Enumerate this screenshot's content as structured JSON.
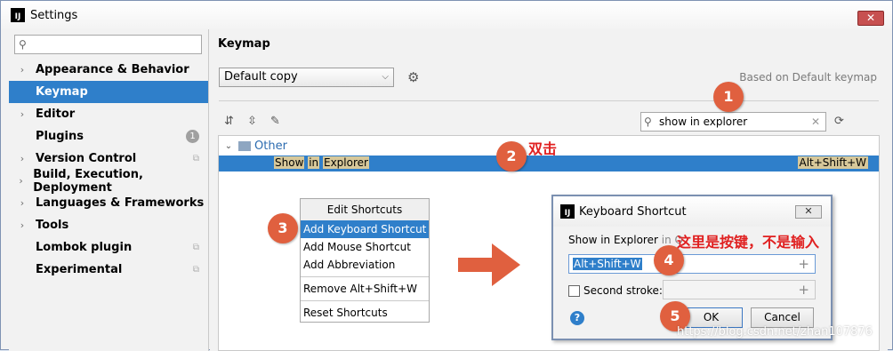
{
  "window": {
    "title": "Settings",
    "app_icon": "IJ"
  },
  "sidebar": {
    "search_placeholder": "",
    "items": [
      {
        "label": "Appearance & Behavior",
        "expandable": true,
        "selected": false,
        "extra": ""
      },
      {
        "label": "Keymap",
        "expandable": false,
        "selected": true,
        "extra": ""
      },
      {
        "label": "Editor",
        "expandable": true,
        "selected": false,
        "extra": ""
      },
      {
        "label": "Plugins",
        "expandable": false,
        "selected": false,
        "extra": "1"
      },
      {
        "label": "Version Control",
        "expandable": true,
        "selected": false,
        "extra": "copy-icon"
      },
      {
        "label": "Build, Execution, Deployment",
        "expandable": true,
        "selected": false,
        "extra": ""
      },
      {
        "label": "Languages & Frameworks",
        "expandable": true,
        "selected": false,
        "extra": ""
      },
      {
        "label": "Tools",
        "expandable": true,
        "selected": false,
        "extra": ""
      },
      {
        "label": "Lombok plugin",
        "expandable": false,
        "selected": false,
        "extra": "copy-icon"
      },
      {
        "label": "Experimental",
        "expandable": false,
        "selected": false,
        "extra": "copy-icon"
      }
    ]
  },
  "main": {
    "title": "Keymap",
    "keymap_value": "Default copy",
    "based_on": "Based on Default keymap",
    "search_value": "show in explorer",
    "tree": {
      "group": "Other",
      "action_parts": [
        "Show",
        "in",
        "Explorer"
      ],
      "shortcut": "Alt+Shift+W"
    }
  },
  "context_menu": {
    "header": "Edit Shortcuts",
    "items": [
      "Add Keyboard Shortcut",
      "Add Mouse Shortcut",
      "Add Abbreviation",
      "Remove Alt+Shift+W",
      "Reset Shortcuts"
    ]
  },
  "dialog": {
    "title": "Keyboard Shortcut",
    "text_main": "Show in Explorer",
    "text_grey": "in O",
    "shortcut_value": "Alt+Shift+W",
    "second_stroke_label": "Second stroke:",
    "ok_label": "OK",
    "cancel_label": "Cancel",
    "help": "?"
  },
  "annotations": {
    "steps": [
      "1",
      "2",
      "3",
      "4",
      "5"
    ],
    "note_double_click": "双击",
    "note_keys": "这里是按键，不是输入",
    "watermark": "https://blog.csdn.net/zhan107876"
  },
  "colors": {
    "selection": "#2f7fca",
    "annotation": "#e0603f",
    "note": "#e02020"
  }
}
